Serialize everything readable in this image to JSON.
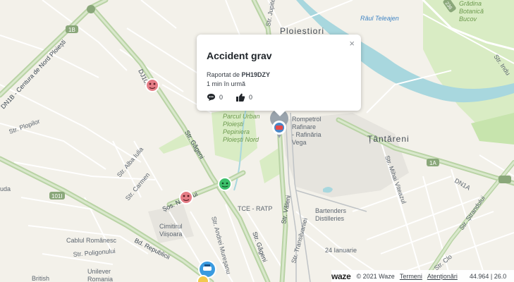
{
  "map": {
    "labels": {
      "ploiesti": "Ploieștiori",
      "rau_teleajen": "Râul Teleajen",
      "gradina_botanica": "Grădina\nBotanică\nBucov",
      "tantareni": "Țântăreni",
      "centura": "DN1B - Centura de Nord Ploiești",
      "dj102": "DJ102",
      "str_gageni": "Str. Găgeni",
      "str_plopilor": "Str. Plopilor",
      "str_alba_iulia": "Str. Alba Iulia",
      "str_carmen": "Str. Carmen",
      "sos_nordului": "Șos. Nordului",
      "cimitirul": "Cimitirul\nViișoara",
      "tce_ratp": "TCE - RATP",
      "str_andrei": "Str. Andrei Mureșanu",
      "str_valeni": "Str. Văleni",
      "str_gageni2": "Str. Găgeni",
      "cablul": "Cablul Românesc",
      "str_poligonului": "Str. Poligonului",
      "bd_republicii": "Bd. Republicii",
      "unilever": "Unilever\nRomania",
      "british": "British",
      "bartenders": "Bartenders\nDistilleries",
      "ianuarie": "24 Ianuarie",
      "str_mihai": "Str. Mihai Viteazul",
      "str_strandului": "Str. Ștrandului",
      "str_clo": "Str. Clo",
      "str_indu": "Str. Indu",
      "str_jupiter": "Str. Jupiter",
      "rompetrol": "Rompetrol\nRafinare\n- Rafinăria\nVega",
      "parc": "Parcul Urban\nPloiești\nPepiniera\nPloiești Nord",
      "dn1a": "DN1A",
      "ruda": "uda",
      "badge_1b": "1B",
      "badge_1a": "1A",
      "badge_1b1": "101I",
      "str_jupiter_short": "Str.",
      "trans": "Str. Transilvaniei",
      "badge_236": "236"
    },
    "colors": {
      "background": "#f3f1ea",
      "major_road": "#b9d3a5",
      "road": "#ffffff",
      "water": "#a8d7de",
      "park": "#d9ecc4",
      "industrial": "#e4e2dc"
    },
    "markers": [
      {
        "type": "hazard-report",
        "color": "#e57d86"
      },
      {
        "type": "hazard-report",
        "color": "#e57d86"
      },
      {
        "type": "chat-report",
        "color": "#3dbf6a"
      },
      {
        "type": "selected-accident",
        "color": "#9aa4ad"
      },
      {
        "type": "police-report",
        "color": "#3a9be0"
      },
      {
        "type": "hazard-report",
        "color": "#f2c94c"
      }
    ]
  },
  "popup": {
    "title": "Accident grav",
    "reported_prefix": "Raportat de",
    "reporter": "PH19DZY",
    "time": "1 min în urmă",
    "comments": "0",
    "thanks": "0",
    "close": "×"
  },
  "footer": {
    "logo": "waze",
    "copyright": "© 2021 Waze",
    "terms": "Termeni",
    "notices": "Atenționări",
    "coords": "44.964 | 26.0"
  }
}
